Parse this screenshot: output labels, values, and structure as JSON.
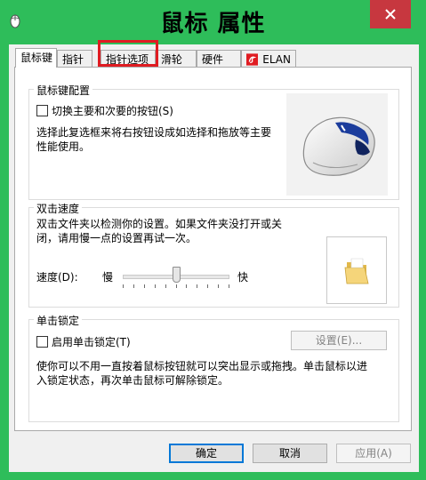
{
  "window": {
    "title": "鼠标 属性",
    "close_icon": "close-icon"
  },
  "tabs": [
    {
      "label": "鼠标键"
    },
    {
      "label": "指针"
    },
    {
      "label": "指针选项"
    },
    {
      "label": "滑轮"
    },
    {
      "label": "硬件"
    },
    {
      "label": "ELAN",
      "icon": "elan-logo-icon"
    }
  ],
  "button_config": {
    "title": "鼠标键配置",
    "checkbox_label": "切换主要和次要的按钮(S)",
    "checked": false,
    "desc_line1": "选择此复选框来将右按钮设成如选择和拖放等主要",
    "desc_line2": "性能使用。"
  },
  "double_click": {
    "title": "双击速度",
    "desc_line1": "双击文件夹以检测你的设置。如果文件夹没打开或关",
    "desc_line2": "闭，请用慢一点的设置再试一次。",
    "speed_label": "速度(D):",
    "slow_label": "慢",
    "fast_label": "快",
    "speed_value": 0.5
  },
  "click_lock": {
    "title": "单击锁定",
    "checkbox_label": "启用单击锁定(T)",
    "checked": false,
    "settings_button": "设置(E)...",
    "desc_line1": "使你可以不用一直按着鼠标按钮就可以突出显示或拖拽。单击鼠标以进",
    "desc_line2": "入锁定状态，再次单击鼠标可解除锁定。"
  },
  "footer": {
    "ok": "确定",
    "cancel": "取消",
    "apply": "应用(A)"
  }
}
